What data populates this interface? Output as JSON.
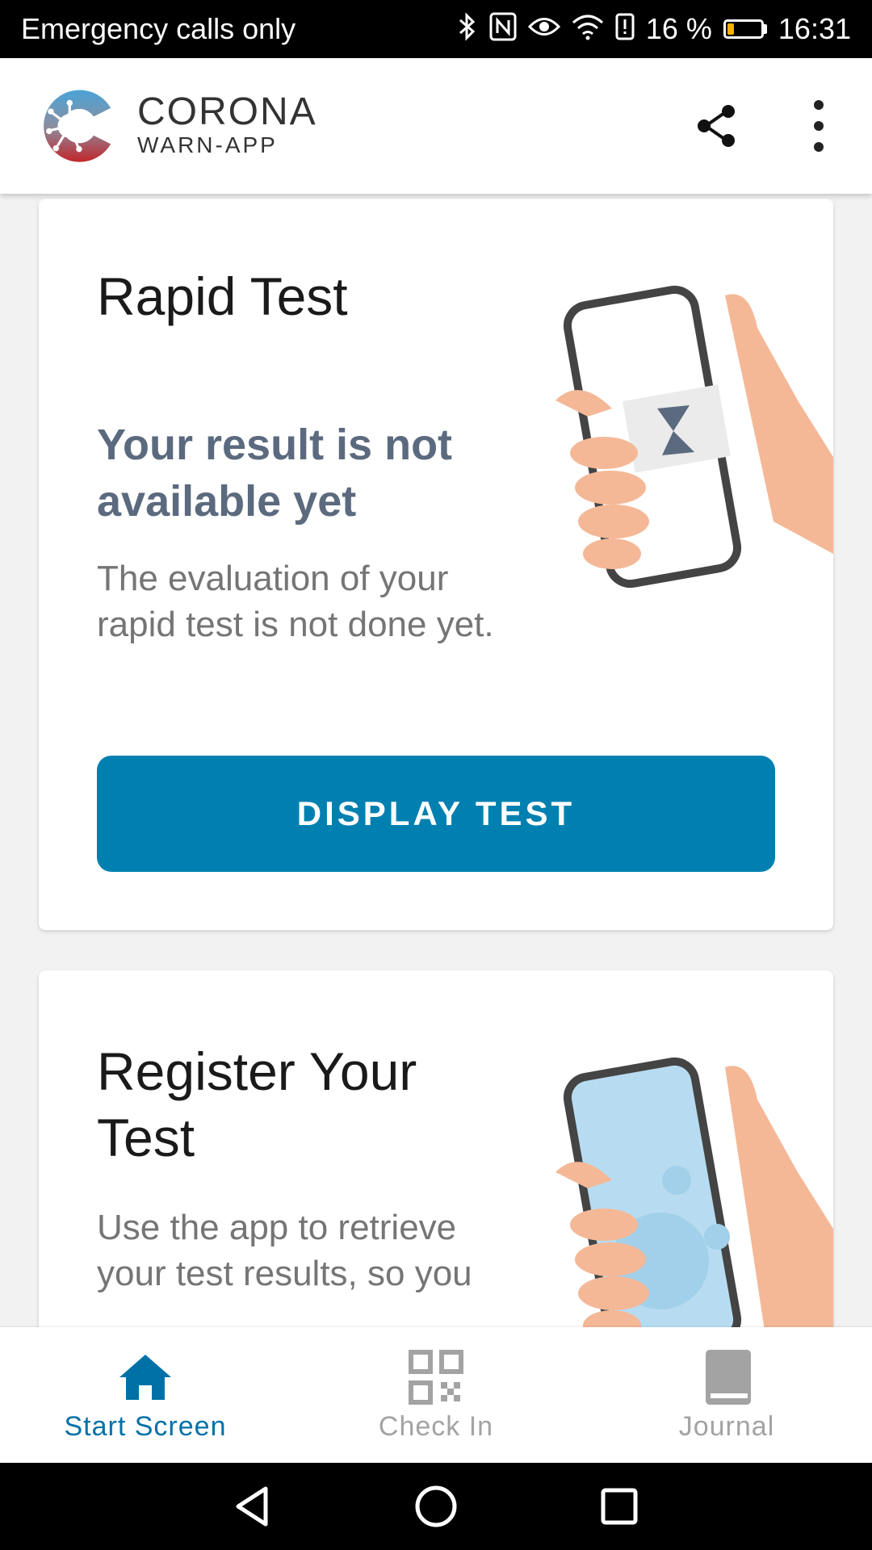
{
  "status_bar": {
    "carrier": "Emergency calls only",
    "battery": "16 %",
    "time": "16:31",
    "icons": [
      "bluetooth-icon",
      "nfc-icon",
      "eye-icon",
      "wifi-icon",
      "alert-icon",
      "battery-icon"
    ]
  },
  "app_bar": {
    "logo_line1": "CORONA",
    "logo_line2": "WARN-APP"
  },
  "rapid_test_card": {
    "title": "Rapid Test",
    "heading": "Your result is not available yet",
    "body": "The evaluation of your rapid test is not done yet.",
    "button": "DISPLAY TEST"
  },
  "register_card": {
    "title": "Register Your Test",
    "body": "Use the app to retrieve your test results, so you"
  },
  "bottom_nav": {
    "items": [
      {
        "label": "Start Screen",
        "icon": "home-icon",
        "active": true
      },
      {
        "label": "Check In",
        "icon": "qr-code-icon",
        "active": false
      },
      {
        "label": "Journal",
        "icon": "book-icon",
        "active": false
      }
    ]
  },
  "colors": {
    "primary": "#0080b0",
    "nav_active": "#0071a7",
    "heading_slate": "#5b6a7e"
  }
}
